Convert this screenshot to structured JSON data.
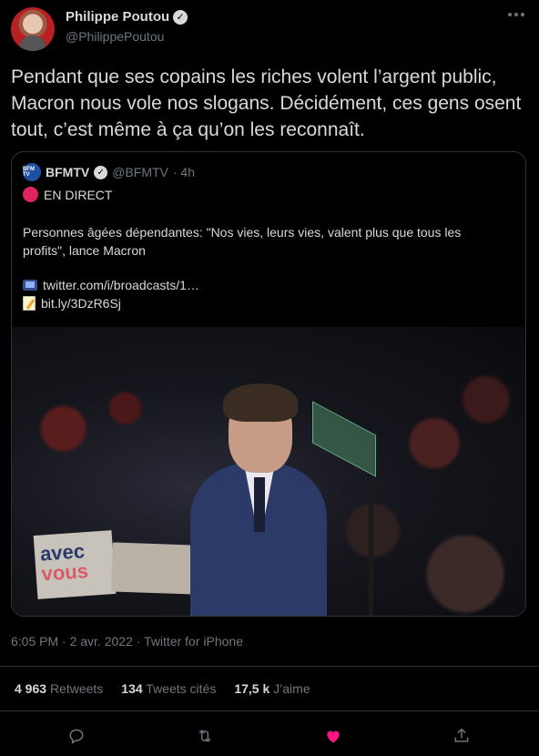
{
  "author": {
    "display_name": "Philippe Poutou",
    "handle": "@PhilippePoutou"
  },
  "tweet": {
    "text": "Pendant que ses copains les riches volent l’argent public, Macron nous vole nos slogans. Décidément, ces gens osent tout, c’est même à ça qu’on les reconnaît.",
    "timestamp": "6:05 PM · 2 avr. 2022 · Twitter for iPhone"
  },
  "quote": {
    "avatar_text": "BFM TV",
    "display_name": "BFMTV",
    "handle": "@BFMTV",
    "time": "· 4h",
    "live_label": "EN DIRECT",
    "body": "Personnes âgées dépendantes: \"Nos vies, leurs vies, valent plus que tous les profits\", lance Macron",
    "link1": "twitter.com/i/broadcasts/1…",
    "link2": "bit.ly/3DzR6Sj",
    "image_sign_line1": "avec",
    "image_sign_line2": "vous"
  },
  "stats": [
    {
      "value": "4 963",
      "label": "Retweets"
    },
    {
      "value": "134",
      "label": "Tweets cités"
    },
    {
      "value": "17,5 k",
      "label": "J’aime"
    }
  ],
  "colors": {
    "background": "#000000",
    "text": "#d9d9d9",
    "muted": "#6e767d",
    "like_active": "#f91880",
    "live_dot": "#e0245e"
  },
  "icons": [
    "more-icon",
    "verified-icon",
    "reply-icon",
    "retweet-icon",
    "like-icon",
    "share-icon",
    "tv-icon",
    "memo-icon"
  ]
}
